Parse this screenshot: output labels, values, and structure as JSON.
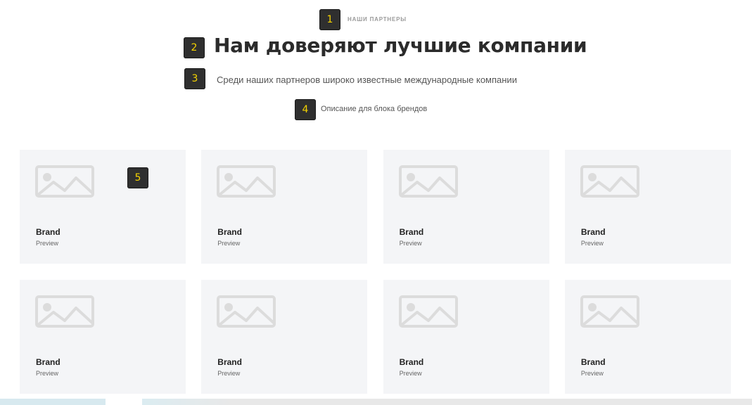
{
  "badges": [
    "1",
    "2",
    "3",
    "4",
    "5"
  ],
  "section": {
    "eyebrow": "НАШИ ПАРТНЕРЫ",
    "title": "Нам доверяют лучшие компании",
    "subtitle": "Среди наших партнеров широко известные международные компании",
    "description": "Описание для блока брендов"
  },
  "cards": [
    {
      "name": "Brand",
      "preview": "Preview",
      "icon": "image-placeholder-icon"
    },
    {
      "name": "Brand",
      "preview": "Preview",
      "icon": "image-placeholder-icon"
    },
    {
      "name": "Brand",
      "preview": "Preview",
      "icon": "image-placeholder-icon"
    },
    {
      "name": "Brand",
      "preview": "Preview",
      "icon": "image-placeholder-icon"
    },
    {
      "name": "Brand",
      "preview": "Preview",
      "icon": "image-placeholder-icon"
    },
    {
      "name": "Brand",
      "preview": "Preview",
      "icon": "image-placeholder-icon"
    },
    {
      "name": "Brand",
      "preview": "Preview",
      "icon": "image-placeholder-icon"
    },
    {
      "name": "Brand",
      "preview": "Preview",
      "icon": "image-placeholder-icon"
    }
  ],
  "colors": {
    "badge_bg": "#2f2f2f",
    "badge_text": "#f5d300",
    "card_bg": "#f4f5f7",
    "placeholder": "#dcdcdc"
  }
}
